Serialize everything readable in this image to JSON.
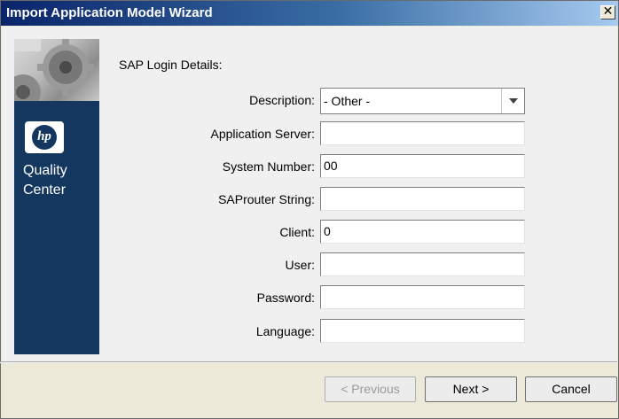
{
  "window": {
    "title": "Import Application Model Wizard",
    "close_glyph": "✕"
  },
  "sidebar": {
    "logo_text": "hp",
    "product_line1": "Quality",
    "product_line2": "Center"
  },
  "form": {
    "section_title": "SAP Login Details:",
    "fields": [
      {
        "label": "Description:",
        "value": "- Other -",
        "type": "select"
      },
      {
        "label": "Application Server:",
        "value": ""
      },
      {
        "label": "System Number:",
        "value": "00"
      },
      {
        "label": "SAProuter String:",
        "value": ""
      },
      {
        "label": "Client:",
        "value": "0"
      },
      {
        "label": "User:",
        "value": ""
      },
      {
        "label": "Password:",
        "value": ""
      },
      {
        "label": "Language:",
        "value": ""
      }
    ]
  },
  "buttons": {
    "previous": "< Previous",
    "next": "Next >",
    "cancel": "Cancel"
  },
  "colors": {
    "title_bar_start": "#0a246a",
    "sidebar_bg": "#14375f"
  },
  "icons": {
    "close": "close-icon",
    "dropdown": "chevron-down-icon",
    "logo": "hp-logo-icon",
    "header_image": "gear-image"
  }
}
